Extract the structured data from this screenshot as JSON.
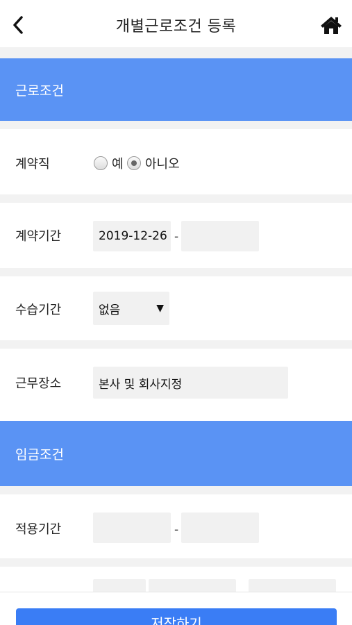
{
  "header": {
    "title": "개별근로조건 등록",
    "back_icon": "chevron-left-icon",
    "home_icon": "home-icon"
  },
  "sections": {
    "work_conditions": {
      "title": "근로조건"
    },
    "wage_conditions": {
      "title": "임금조건"
    }
  },
  "fields": {
    "contract": {
      "label": "계약직",
      "options": [
        {
          "label": "예",
          "selected": false
        },
        {
          "label": "아니오",
          "selected": true
        }
      ]
    },
    "contract_period": {
      "label": "계약기간",
      "start": "2019-12-26",
      "separator": "-",
      "end": ""
    },
    "probation": {
      "label": "수습기간",
      "selected": "없음"
    },
    "workplace": {
      "label": "근무장소",
      "value": "본사 및 회사지정"
    },
    "apply_period": {
      "label": "적용기간",
      "start": "",
      "separator": "-",
      "end": ""
    }
  },
  "footer": {
    "save_label": "저장하기"
  },
  "colors": {
    "section_bg": "#5a93f4",
    "button_bg": "#3a7df5",
    "field_bg": "#f1f1f1",
    "gap_bg": "#f2f2f2"
  }
}
